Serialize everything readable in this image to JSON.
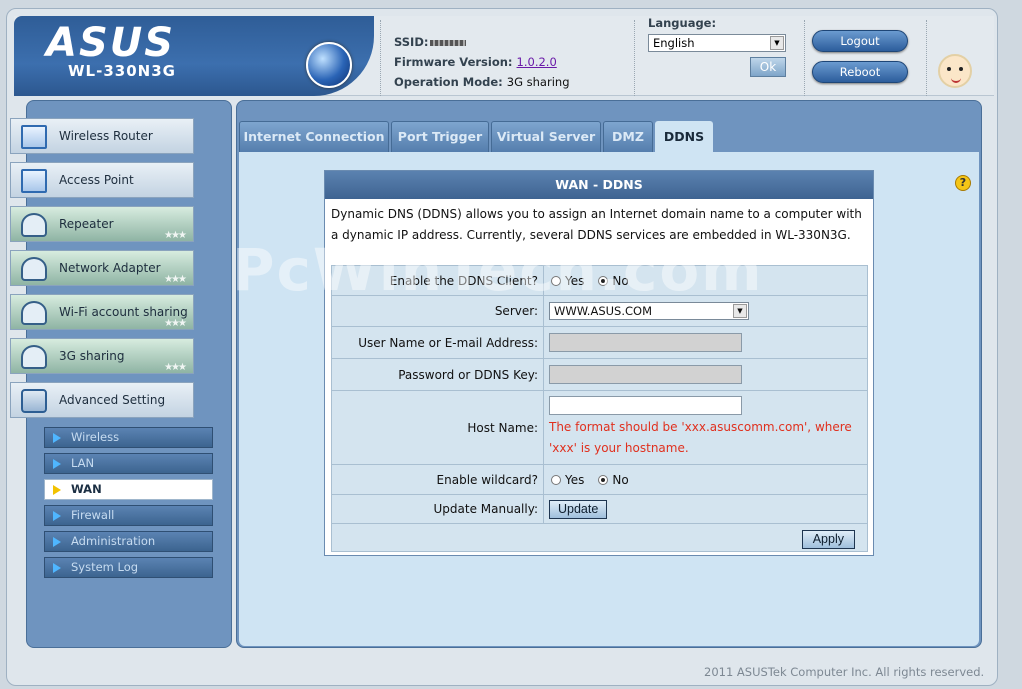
{
  "brand": {
    "logo": "/ISUS",
    "model": "WL-330N3G"
  },
  "info": {
    "ssid_label": "SSID:",
    "firmware_label": "Firmware Version:",
    "firmware_value": "1.0.2.0",
    "mode_label": "Operation Mode:",
    "mode_value": "3G sharing"
  },
  "language": {
    "label": "Language:",
    "selected": "English",
    "ok": "Ok"
  },
  "actions": {
    "logout": "Logout",
    "reboot": "Reboot"
  },
  "sidebar": {
    "main": [
      {
        "label": "Wireless Router",
        "icon": "router-icon"
      },
      {
        "label": "Access Point",
        "icon": "access-point-icon"
      },
      {
        "label": "Repeater",
        "icon": "repeater-icon"
      },
      {
        "label": "Network Adapter",
        "icon": "network-adapter-icon"
      },
      {
        "label": "Wi-Fi account sharing",
        "icon": "wifi-sharing-icon"
      },
      {
        "label": "3G sharing",
        "icon": "3g-sharing-icon"
      },
      {
        "label": "Advanced Setting",
        "icon": "tools-icon"
      }
    ],
    "sub": [
      "Wireless",
      "LAN",
      "WAN",
      "Firewall",
      "Administration",
      "System Log"
    ],
    "active_sub": "WAN"
  },
  "tabs": [
    "Internet Connection",
    "Port Trigger",
    "Virtual Server",
    "DMZ",
    "DDNS"
  ],
  "active_tab": "DDNS",
  "panel": {
    "title": "WAN - DDNS",
    "description": "Dynamic DNS (DDNS) allows you to assign an Internet domain name to a computer with a dynamic IP address. Currently, several DDNS services are embedded in WL-330N3G.",
    "enable_label": "Enable the DDNS Client?",
    "yes": "Yes",
    "no": "No",
    "server_label": "Server:",
    "server_value": "WWW.ASUS.COM",
    "username_label": "User Name or E-mail Address:",
    "password_label": "Password or DDNS Key:",
    "hostname_label": "Host Name:",
    "hostname_hint": "The format should be 'xxx.asuscomm.com', where 'xxx' is your hostname.",
    "wildcard_label": "Enable wildcard?",
    "update_label": "Update Manually:",
    "update_button": "Update",
    "apply_button": "Apply"
  },
  "help": "?",
  "watermark": "PcWinTech.com",
  "footer": "2011 ASUSTek Computer Inc. All rights reserved."
}
